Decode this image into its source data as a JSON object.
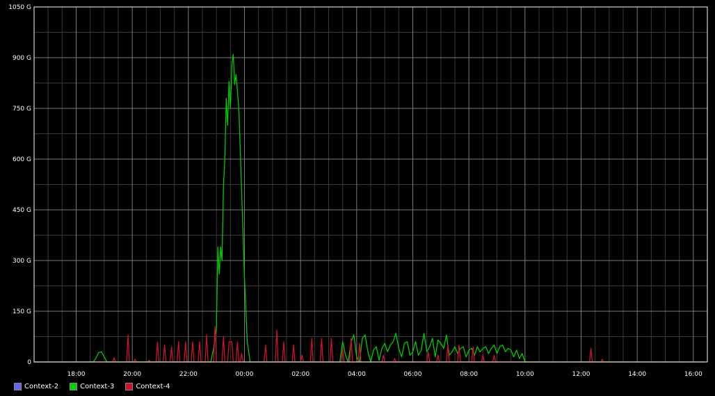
{
  "chart_data": {
    "type": "line",
    "title": "",
    "xlabel": "",
    "ylabel": "",
    "x_unit": "hours from 16:30 (day 1)",
    "x_ticks": [
      "18:00",
      "20:00",
      "22:00",
      "00:00",
      "02:00",
      "04:00",
      "06:00",
      "08:00",
      "10:00",
      "12:00",
      "14:00",
      "16:00"
    ],
    "y_ticks": [
      "0",
      "150 G",
      "300 G",
      "450 G",
      "600 G",
      "750 G",
      "900 G",
      "1050 G"
    ],
    "ylim": [
      0,
      1050
    ],
    "grid": true,
    "legend_position": "bottom-left",
    "series": [
      {
        "name": "Context-2",
        "color": "#6666ee",
        "points": []
      },
      {
        "name": "Context-3",
        "color": "#00cc00",
        "points": [
          [
            0,
            0
          ],
          [
            2.1,
            0
          ],
          [
            2.2,
            10
          ],
          [
            2.3,
            28
          ],
          [
            2.4,
            30
          ],
          [
            2.5,
            15
          ],
          [
            2.6,
            0
          ],
          [
            6.3,
            0
          ],
          [
            6.4,
            40
          ],
          [
            6.5,
            100
          ],
          [
            6.55,
            340
          ],
          [
            6.6,
            260
          ],
          [
            6.65,
            340
          ],
          [
            6.7,
            300
          ],
          [
            6.75,
            520
          ],
          [
            6.8,
            600
          ],
          [
            6.85,
            780
          ],
          [
            6.9,
            700
          ],
          [
            6.95,
            830
          ],
          [
            7.0,
            750
          ],
          [
            7.05,
            880
          ],
          [
            7.1,
            910
          ],
          [
            7.15,
            820
          ],
          [
            7.2,
            850
          ],
          [
            7.3,
            750
          ],
          [
            7.4,
            500
          ],
          [
            7.5,
            250
          ],
          [
            7.6,
            60
          ],
          [
            7.7,
            0
          ],
          [
            10.9,
            0
          ],
          [
            11.0,
            60
          ],
          [
            11.1,
            20
          ],
          [
            11.2,
            0
          ],
          [
            11.3,
            60
          ],
          [
            11.4,
            80
          ],
          [
            11.5,
            15
          ],
          [
            11.6,
            0
          ],
          [
            11.7,
            70
          ],
          [
            11.8,
            80
          ],
          [
            11.9,
            30
          ],
          [
            12.0,
            0
          ],
          [
            12.1,
            35
          ],
          [
            12.2,
            45
          ],
          [
            12.3,
            5
          ],
          [
            12.4,
            40
          ],
          [
            12.5,
            55
          ],
          [
            12.6,
            30
          ],
          [
            12.7,
            50
          ],
          [
            12.8,
            60
          ],
          [
            12.9,
            85
          ],
          [
            13.0,
            40
          ],
          [
            13.1,
            15
          ],
          [
            13.2,
            55
          ],
          [
            13.3,
            60
          ],
          [
            13.4,
            20
          ],
          [
            13.5,
            30
          ],
          [
            13.6,
            60
          ],
          [
            13.7,
            20
          ],
          [
            13.8,
            35
          ],
          [
            13.9,
            85
          ],
          [
            14.0,
            30
          ],
          [
            14.1,
            45
          ],
          [
            14.2,
            70
          ],
          [
            14.3,
            15
          ],
          [
            14.4,
            65
          ],
          [
            14.5,
            55
          ],
          [
            14.6,
            40
          ],
          [
            14.7,
            80
          ],
          [
            14.8,
            20
          ],
          [
            14.9,
            30
          ],
          [
            15.0,
            45
          ],
          [
            15.1,
            25
          ],
          [
            15.2,
            40
          ],
          [
            15.3,
            45
          ],
          [
            15.4,
            15
          ],
          [
            15.5,
            35
          ],
          [
            15.6,
            40
          ],
          [
            15.7,
            20
          ],
          [
            15.8,
            45
          ],
          [
            15.9,
            30
          ],
          [
            16.0,
            40
          ],
          [
            16.1,
            45
          ],
          [
            16.2,
            25
          ],
          [
            16.3,
            40
          ],
          [
            16.4,
            50
          ],
          [
            16.5,
            25
          ],
          [
            16.6,
            45
          ],
          [
            16.7,
            50
          ],
          [
            16.8,
            30
          ],
          [
            16.9,
            40
          ],
          [
            17.0,
            35
          ],
          [
            17.1,
            15
          ],
          [
            17.2,
            35
          ],
          [
            17.3,
            10
          ],
          [
            17.4,
            25
          ],
          [
            17.5,
            0
          ],
          [
            23.9,
            0
          ]
        ]
      },
      {
        "name": "Context-4",
        "color": "#cc1133",
        "points": [
          [
            0,
            0
          ],
          [
            2.8,
            0
          ],
          [
            2.85,
            12
          ],
          [
            2.9,
            0
          ],
          [
            3.3,
            0
          ],
          [
            3.35,
            80
          ],
          [
            3.4,
            0
          ],
          [
            3.55,
            0
          ],
          [
            3.6,
            8
          ],
          [
            3.65,
            0
          ],
          [
            4.05,
            0
          ],
          [
            4.1,
            5
          ],
          [
            4.15,
            0
          ],
          [
            4.35,
            0
          ],
          [
            4.4,
            60
          ],
          [
            4.45,
            0
          ],
          [
            4.6,
            0
          ],
          [
            4.65,
            50
          ],
          [
            4.7,
            0
          ],
          [
            4.85,
            0
          ],
          [
            4.9,
            45
          ],
          [
            4.95,
            0
          ],
          [
            5.1,
            0
          ],
          [
            5.15,
            60
          ],
          [
            5.2,
            0
          ],
          [
            5.35,
            0
          ],
          [
            5.4,
            60
          ],
          [
            5.45,
            0
          ],
          [
            5.6,
            0
          ],
          [
            5.65,
            60
          ],
          [
            5.7,
            0
          ],
          [
            5.85,
            0
          ],
          [
            5.9,
            60
          ],
          [
            5.95,
            0
          ],
          [
            6.1,
            0
          ],
          [
            6.15,
            80
          ],
          [
            6.2,
            0
          ],
          [
            6.4,
            0
          ],
          [
            6.45,
            105
          ],
          [
            6.5,
            0
          ],
          [
            6.7,
            0
          ],
          [
            6.75,
            75
          ],
          [
            6.8,
            0
          ],
          [
            6.9,
            0
          ],
          [
            6.95,
            60
          ],
          [
            7.05,
            60
          ],
          [
            7.1,
            0
          ],
          [
            7.2,
            0
          ],
          [
            7.25,
            60
          ],
          [
            7.3,
            0
          ],
          [
            7.35,
            0
          ],
          [
            7.4,
            25
          ],
          [
            7.45,
            0
          ],
          [
            8.2,
            0
          ],
          [
            8.25,
            50
          ],
          [
            8.3,
            0
          ],
          [
            8.6,
            0
          ],
          [
            8.65,
            95
          ],
          [
            8.7,
            0
          ],
          [
            8.85,
            0
          ],
          [
            8.9,
            60
          ],
          [
            8.95,
            0
          ],
          [
            9.2,
            0
          ],
          [
            9.25,
            50
          ],
          [
            9.3,
            0
          ],
          [
            9.5,
            0
          ],
          [
            9.55,
            20
          ],
          [
            9.6,
            0
          ],
          [
            9.85,
            0
          ],
          [
            9.9,
            70
          ],
          [
            9.95,
            0
          ],
          [
            10.2,
            0
          ],
          [
            10.25,
            70
          ],
          [
            10.3,
            0
          ],
          [
            10.55,
            0
          ],
          [
            10.6,
            70
          ],
          [
            10.65,
            0
          ],
          [
            10.95,
            0
          ],
          [
            11.0,
            40
          ],
          [
            11.05,
            0
          ],
          [
            11.25,
            0
          ],
          [
            11.3,
            70
          ],
          [
            11.35,
            0
          ],
          [
            11.55,
            0
          ],
          [
            11.6,
            55
          ],
          [
            11.65,
            0
          ],
          [
            12.4,
            0
          ],
          [
            12.45,
            20
          ],
          [
            12.5,
            0
          ],
          [
            12.8,
            0
          ],
          [
            12.85,
            10
          ],
          [
            12.9,
            0
          ],
          [
            14.0,
            0
          ],
          [
            14.05,
            30
          ],
          [
            14.1,
            0
          ],
          [
            14.35,
            0
          ],
          [
            14.4,
            20
          ],
          [
            14.45,
            0
          ],
          [
            14.7,
            0
          ],
          [
            14.75,
            50
          ],
          [
            14.8,
            0
          ],
          [
            15.1,
            0
          ],
          [
            15.15,
            50
          ],
          [
            15.2,
            0
          ],
          [
            15.6,
            0
          ],
          [
            15.65,
            45
          ],
          [
            15.7,
            0
          ],
          [
            15.95,
            0
          ],
          [
            16.0,
            20
          ],
          [
            16.05,
            0
          ],
          [
            16.35,
            0
          ],
          [
            16.4,
            20
          ],
          [
            16.45,
            0
          ],
          [
            19.8,
            0
          ],
          [
            19.85,
            40
          ],
          [
            19.9,
            0
          ],
          [
            20.2,
            0
          ],
          [
            20.25,
            8
          ],
          [
            20.3,
            0
          ],
          [
            23.9,
            0
          ]
        ]
      }
    ]
  },
  "legend": [
    {
      "label": "Context-2",
      "color": "#6666ee"
    },
    {
      "label": "Context-3",
      "color": "#00cc00"
    },
    {
      "label": "Context-4",
      "color": "#cc1133"
    }
  ]
}
